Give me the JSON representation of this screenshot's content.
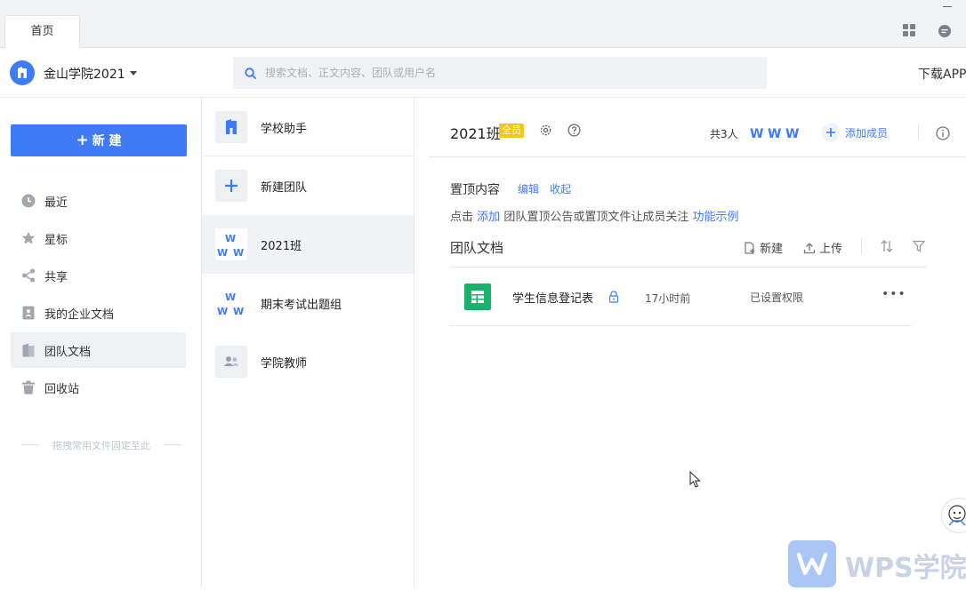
{
  "tabs": [
    {
      "label": "首页",
      "active": true
    }
  ],
  "header": {
    "org_name": "金山学院2021",
    "search_placeholder": "搜索文档、正文内容、团队或用户名",
    "download_label": "下载APP"
  },
  "sidebar": {
    "new_button": "新 建",
    "items": [
      {
        "label": "最近",
        "icon": "clock-icon"
      },
      {
        "label": "星标",
        "icon": "star-icon"
      },
      {
        "label": "共享",
        "icon": "share-icon"
      },
      {
        "label": "我的企业文档",
        "icon": "enterprise-doc-icon"
      },
      {
        "label": "团队文档",
        "icon": "team-doc-icon",
        "active": true
      },
      {
        "label": "回收站",
        "icon": "trash-icon"
      }
    ],
    "pin_hint": "拖拽常用文件固定至此"
  },
  "teams": [
    {
      "name": "学校助手"
    },
    {
      "name": "新建团队"
    },
    {
      "name": "2021班",
      "active": true
    },
    {
      "name": "期末考试出题组"
    },
    {
      "name": "学院教师"
    }
  ],
  "main": {
    "team_title": "2021班",
    "team_badge": "全员",
    "member_count": "共3人",
    "add_member": "添加成员",
    "pinned": {
      "title": "置顶内容",
      "edit": "编辑",
      "collapse": "收起",
      "hint_prefix": "点击",
      "hint_add": "添加",
      "hint_middle": "团队置顶公告或置顶文件让成员关注",
      "hint_example": "功能示例"
    },
    "docs": {
      "title": "团队文档",
      "new_label": "新建",
      "upload_label": "上传",
      "files": [
        {
          "name": "学生信息登记表",
          "time": "17小时前",
          "permission": "已设置权限",
          "locked": true
        }
      ]
    }
  },
  "watermark": {
    "text": "WPS学院"
  },
  "colors": {
    "accent": "#3e7bf5",
    "badge": "#f5c518",
    "sheet": "#19b26b"
  }
}
